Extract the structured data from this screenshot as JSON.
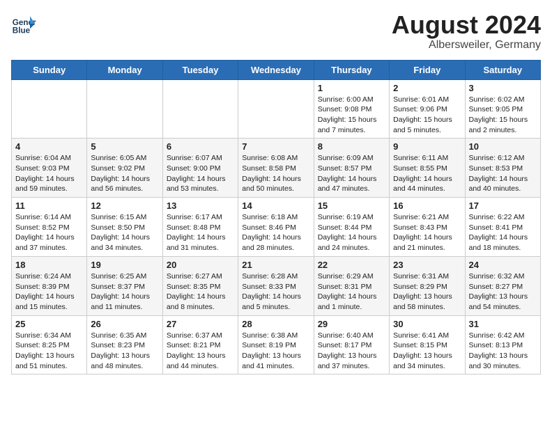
{
  "header": {
    "logo_line1": "General",
    "logo_line2": "Blue",
    "month_year": "August 2024",
    "location": "Albersweiler, Germany"
  },
  "weekdays": [
    "Sunday",
    "Monday",
    "Tuesday",
    "Wednesday",
    "Thursday",
    "Friday",
    "Saturday"
  ],
  "weeks": [
    [
      {
        "day": "",
        "info": ""
      },
      {
        "day": "",
        "info": ""
      },
      {
        "day": "",
        "info": ""
      },
      {
        "day": "",
        "info": ""
      },
      {
        "day": "1",
        "info": "Sunrise: 6:00 AM\nSunset: 9:08 PM\nDaylight: 15 hours\nand 7 minutes."
      },
      {
        "day": "2",
        "info": "Sunrise: 6:01 AM\nSunset: 9:06 PM\nDaylight: 15 hours\nand 5 minutes."
      },
      {
        "day": "3",
        "info": "Sunrise: 6:02 AM\nSunset: 9:05 PM\nDaylight: 15 hours\nand 2 minutes."
      }
    ],
    [
      {
        "day": "4",
        "info": "Sunrise: 6:04 AM\nSunset: 9:03 PM\nDaylight: 14 hours\nand 59 minutes."
      },
      {
        "day": "5",
        "info": "Sunrise: 6:05 AM\nSunset: 9:02 PM\nDaylight: 14 hours\nand 56 minutes."
      },
      {
        "day": "6",
        "info": "Sunrise: 6:07 AM\nSunset: 9:00 PM\nDaylight: 14 hours\nand 53 minutes."
      },
      {
        "day": "7",
        "info": "Sunrise: 6:08 AM\nSunset: 8:58 PM\nDaylight: 14 hours\nand 50 minutes."
      },
      {
        "day": "8",
        "info": "Sunrise: 6:09 AM\nSunset: 8:57 PM\nDaylight: 14 hours\nand 47 minutes."
      },
      {
        "day": "9",
        "info": "Sunrise: 6:11 AM\nSunset: 8:55 PM\nDaylight: 14 hours\nand 44 minutes."
      },
      {
        "day": "10",
        "info": "Sunrise: 6:12 AM\nSunset: 8:53 PM\nDaylight: 14 hours\nand 40 minutes."
      }
    ],
    [
      {
        "day": "11",
        "info": "Sunrise: 6:14 AM\nSunset: 8:52 PM\nDaylight: 14 hours\nand 37 minutes."
      },
      {
        "day": "12",
        "info": "Sunrise: 6:15 AM\nSunset: 8:50 PM\nDaylight: 14 hours\nand 34 minutes."
      },
      {
        "day": "13",
        "info": "Sunrise: 6:17 AM\nSunset: 8:48 PM\nDaylight: 14 hours\nand 31 minutes."
      },
      {
        "day": "14",
        "info": "Sunrise: 6:18 AM\nSunset: 8:46 PM\nDaylight: 14 hours\nand 28 minutes."
      },
      {
        "day": "15",
        "info": "Sunrise: 6:19 AM\nSunset: 8:44 PM\nDaylight: 14 hours\nand 24 minutes."
      },
      {
        "day": "16",
        "info": "Sunrise: 6:21 AM\nSunset: 8:43 PM\nDaylight: 14 hours\nand 21 minutes."
      },
      {
        "day": "17",
        "info": "Sunrise: 6:22 AM\nSunset: 8:41 PM\nDaylight: 14 hours\nand 18 minutes."
      }
    ],
    [
      {
        "day": "18",
        "info": "Sunrise: 6:24 AM\nSunset: 8:39 PM\nDaylight: 14 hours\nand 15 minutes."
      },
      {
        "day": "19",
        "info": "Sunrise: 6:25 AM\nSunset: 8:37 PM\nDaylight: 14 hours\nand 11 minutes."
      },
      {
        "day": "20",
        "info": "Sunrise: 6:27 AM\nSunset: 8:35 PM\nDaylight: 14 hours\nand 8 minutes."
      },
      {
        "day": "21",
        "info": "Sunrise: 6:28 AM\nSunset: 8:33 PM\nDaylight: 14 hours\nand 5 minutes."
      },
      {
        "day": "22",
        "info": "Sunrise: 6:29 AM\nSunset: 8:31 PM\nDaylight: 14 hours\nand 1 minute."
      },
      {
        "day": "23",
        "info": "Sunrise: 6:31 AM\nSunset: 8:29 PM\nDaylight: 13 hours\nand 58 minutes."
      },
      {
        "day": "24",
        "info": "Sunrise: 6:32 AM\nSunset: 8:27 PM\nDaylight: 13 hours\nand 54 minutes."
      }
    ],
    [
      {
        "day": "25",
        "info": "Sunrise: 6:34 AM\nSunset: 8:25 PM\nDaylight: 13 hours\nand 51 minutes."
      },
      {
        "day": "26",
        "info": "Sunrise: 6:35 AM\nSunset: 8:23 PM\nDaylight: 13 hours\nand 48 minutes."
      },
      {
        "day": "27",
        "info": "Sunrise: 6:37 AM\nSunset: 8:21 PM\nDaylight: 13 hours\nand 44 minutes."
      },
      {
        "day": "28",
        "info": "Sunrise: 6:38 AM\nSunset: 8:19 PM\nDaylight: 13 hours\nand 41 minutes."
      },
      {
        "day": "29",
        "info": "Sunrise: 6:40 AM\nSunset: 8:17 PM\nDaylight: 13 hours\nand 37 minutes."
      },
      {
        "day": "30",
        "info": "Sunrise: 6:41 AM\nSunset: 8:15 PM\nDaylight: 13 hours\nand 34 minutes."
      },
      {
        "day": "31",
        "info": "Sunrise: 6:42 AM\nSunset: 8:13 PM\nDaylight: 13 hours\nand 30 minutes."
      }
    ]
  ]
}
